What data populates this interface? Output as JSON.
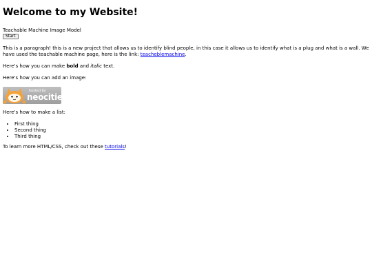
{
  "heading": "Welcome to my Website!",
  "model": {
    "label": "Teachable Machine Image Model",
    "start_button": "Start"
  },
  "intro": {
    "text": "This is a paragraph! this is a new project that allows us to identify blind people, in this case it allows us to identify what is a plug and what is a wall. We have used the teachable machine page, here is the link: ",
    "link_text": "teacheblemachine",
    "trailing": "."
  },
  "formatting": {
    "prefix": "Here's how you can make ",
    "bold": "bold",
    "middle": " and ",
    "italic": "italic",
    "suffix": " text."
  },
  "image_section": {
    "label": "Here's how you can add an image:",
    "badge": {
      "hosted_by": "hosted by",
      "brand": "neocities",
      "icon": "neocities-cat-icon"
    }
  },
  "list_section": {
    "label": "Here's how to make a list:",
    "items": [
      "First thing",
      "Second thing",
      "Third thing"
    ]
  },
  "footer": {
    "prefix": "To learn more HTML/CSS, check out these ",
    "link_text": "tutorials",
    "suffix": "!"
  },
  "colors": {
    "link": "#0000ee",
    "badge_bg": "#a8a8a8"
  }
}
